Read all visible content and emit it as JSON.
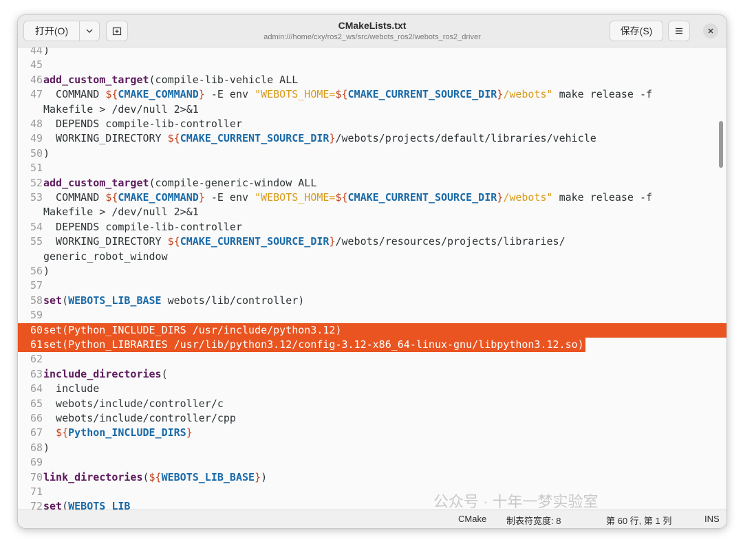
{
  "header": {
    "open_label": "打开(O)",
    "open_menu_icon": "chevron-down-icon",
    "new_tab_icon": "new-tab-icon",
    "title": "CMakeLists.txt",
    "path": "admin:///home/cxy/ros2_ws/src/webots_ros2/webots_ros2_driver",
    "save_label": "保存(S)",
    "menu_icon": "hamburger-menu-icon",
    "close_icon": "close-icon"
  },
  "editor": {
    "lines": [
      {
        "n": "44",
        "t": ")"
      },
      {
        "n": "45",
        "t": ""
      },
      {
        "n": "46",
        "t": "add_custom_target(compile-lib-vehicle ALL"
      },
      {
        "n": "47",
        "t": "  COMMAND ${CMAKE_COMMAND} -E env \"WEBOTS_HOME=${CMAKE_CURRENT_SOURCE_DIR}/webots\" make release -f"
      },
      {
        "n": "",
        "t": "Makefile > /dev/null 2>&1"
      },
      {
        "n": "48",
        "t": "  DEPENDS compile-lib-controller"
      },
      {
        "n": "49",
        "t": "  WORKING_DIRECTORY ${CMAKE_CURRENT_SOURCE_DIR}/webots/projects/default/libraries/vehicle"
      },
      {
        "n": "50",
        "t": ")"
      },
      {
        "n": "51",
        "t": ""
      },
      {
        "n": "52",
        "t": "add_custom_target(compile-generic-window ALL"
      },
      {
        "n": "53",
        "t": "  COMMAND ${CMAKE_COMMAND} -E env \"WEBOTS_HOME=${CMAKE_CURRENT_SOURCE_DIR}/webots\" make release -f"
      },
      {
        "n": "",
        "t": "Makefile > /dev/null 2>&1"
      },
      {
        "n": "54",
        "t": "  DEPENDS compile-lib-controller"
      },
      {
        "n": "55",
        "t": "  WORKING_DIRECTORY ${CMAKE_CURRENT_SOURCE_DIR}/webots/resources/projects/libraries/"
      },
      {
        "n": "",
        "t": "generic_robot_window"
      },
      {
        "n": "56",
        "t": ")"
      },
      {
        "n": "57",
        "t": ""
      },
      {
        "n": "58",
        "t": "set(WEBOTS_LIB_BASE webots/lib/controller)"
      },
      {
        "n": "59",
        "t": ""
      },
      {
        "n": "60",
        "t": "set(Python_INCLUDE_DIRS /usr/include/python3.12)"
      },
      {
        "n": "61",
        "t": "set(Python_LIBRARIES /usr/lib/python3.12/config-3.12-x86_64-linux-gnu/libpython3.12.so)"
      },
      {
        "n": "62",
        "t": ""
      },
      {
        "n": "63",
        "t": "include_directories("
      },
      {
        "n": "64",
        "t": "  include"
      },
      {
        "n": "65",
        "t": "  webots/include/controller/c"
      },
      {
        "n": "66",
        "t": "  webots/include/controller/cpp"
      },
      {
        "n": "67",
        "t": "  ${Python_INCLUDE_DIRS}"
      },
      {
        "n": "68",
        "t": ")"
      },
      {
        "n": "69",
        "t": ""
      },
      {
        "n": "70",
        "t": "link_directories(${WEBOTS_LIB_BASE})"
      },
      {
        "n": "71",
        "t": ""
      },
      {
        "n": "72",
        "t": "set(WEBOTS_LIB"
      }
    ],
    "selected_lines": [
      "60",
      "61"
    ]
  },
  "status": {
    "language": "CMake",
    "tab_width": "制表符宽度: 8",
    "position": "第 60 行, 第 1 列",
    "mode": "INS"
  },
  "watermark": "公众号 · 十年一梦实验室",
  "colors": {
    "accent": "#e95420",
    "function": "#5c1a5c",
    "variable": "#1a6aa8",
    "string": "#d89a1a"
  }
}
